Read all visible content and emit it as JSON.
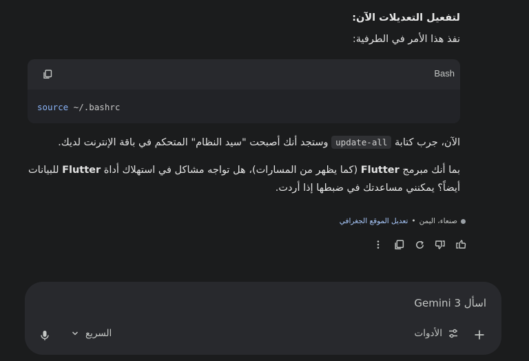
{
  "message": {
    "heading": "لتفعيل التعديلات الآن:",
    "instruction": "نفذ هذا الأمر في الطرفية:",
    "code_block": {
      "language": "Bash",
      "keyword": "source",
      "argument": " ~/.bashrc"
    },
    "para1_before": "الآن، جرب كتابة ",
    "para1_code": "update-all",
    "para1_after": " وستجد أنك أصبحت \"سيد النظام\" المتحكم في باقة الإنترنت لديك.",
    "para2_a": "بما أنك مبرمج ",
    "para2_bold1": "Flutter",
    "para2_b": " (كما يظهر من المسارات)، هل تواجه مشاكل في استهلاك أداة ",
    "para2_bold2": "Flutter",
    "para2_c": " للبيانات أيضاً؟ يمكنني مساعدتك في ضبطها إذا أردت."
  },
  "location": {
    "place": "صنعاء، اليمن",
    "separator": "•",
    "update_link": "تعديل الموقع الجغرافي"
  },
  "actions": [
    "thumb-up-icon",
    "thumb-down-icon",
    "regenerate-icon",
    "copy-icon",
    "more-vert-icon"
  ],
  "composer": {
    "prompt": "اسأل Gemini 3",
    "tools_label": "الأدوات",
    "mode_label": "السريع"
  },
  "colors": {
    "background": "#1b1c1d",
    "code_bg": "#222327",
    "composer_bg": "#28292d",
    "link": "#a8c7fa",
    "keyword": "#8ab4f8"
  }
}
